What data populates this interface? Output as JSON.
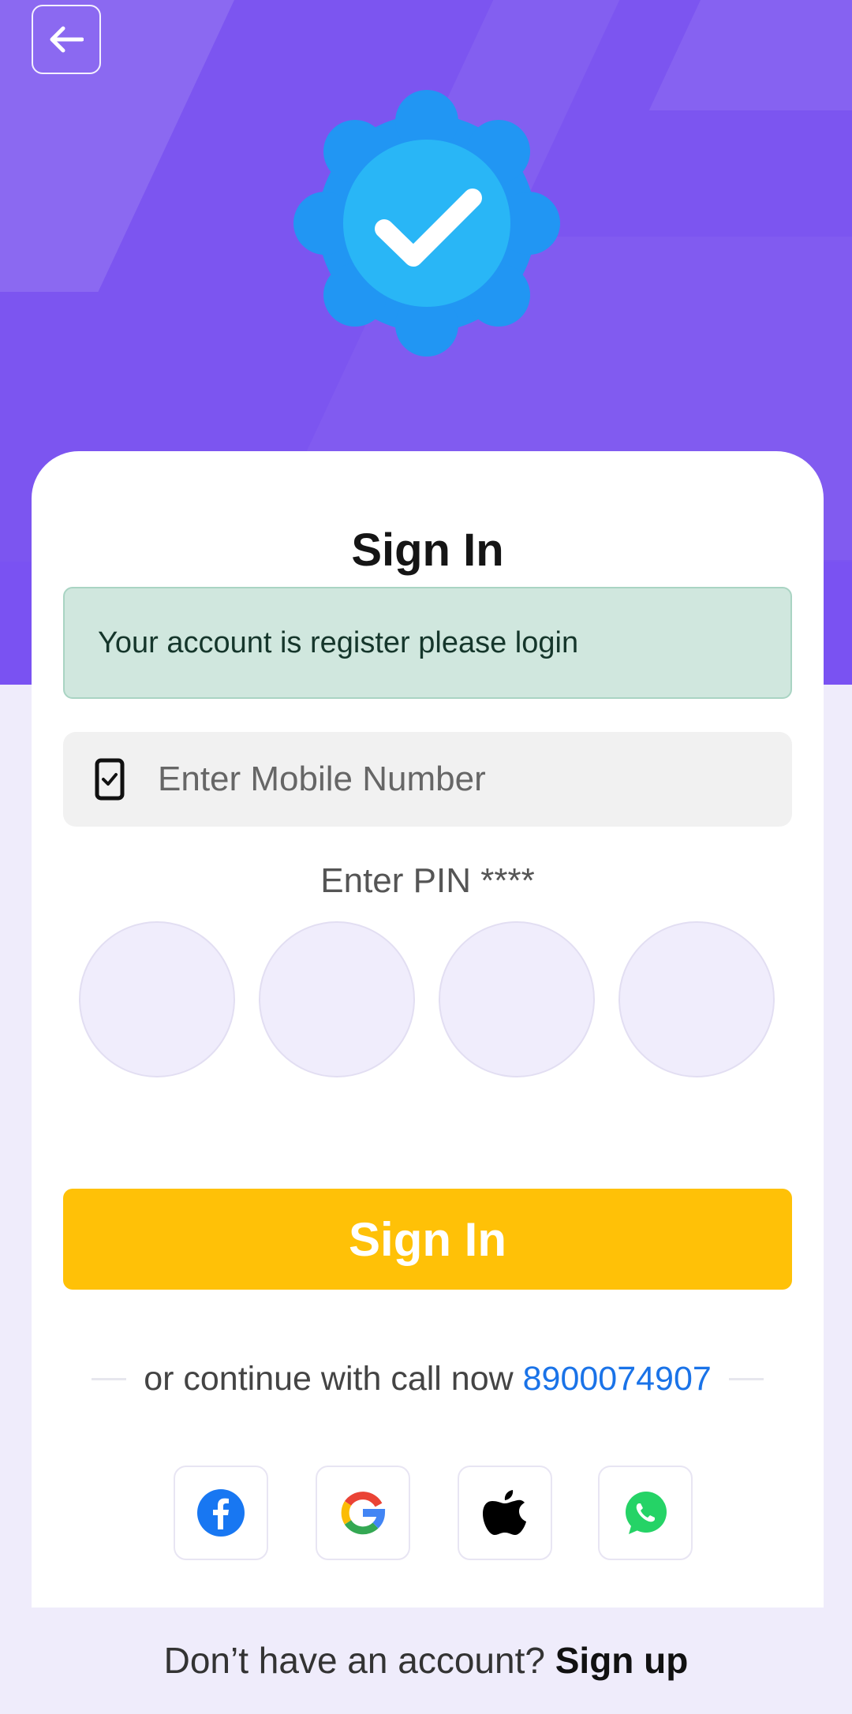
{
  "header": {
    "back_icon": "arrow-left-icon",
    "badge_icon": "verified-check-badge-icon",
    "colors": {
      "purple": "#7c55f0",
      "badge_outer": "#2196f3",
      "badge_inner": "#29b6f6"
    }
  },
  "form": {
    "title": "Sign In",
    "alert_text": "Your account is register please login",
    "mobile_placeholder": "Enter Mobile Number",
    "mobile_icon": "mobile-check-icon",
    "pin_label": "Enter PIN ****",
    "pin_digits": [
      "",
      "",
      "",
      ""
    ],
    "submit_label": "Sign In",
    "submit_color": "#ffc107"
  },
  "alt_login": {
    "prefix": "or continue with call now",
    "phone": "8900074907",
    "providers": [
      {
        "name": "facebook",
        "icon": "facebook-icon"
      },
      {
        "name": "google",
        "icon": "google-icon"
      },
      {
        "name": "apple",
        "icon": "apple-icon"
      },
      {
        "name": "whatsapp",
        "icon": "whatsapp-icon"
      }
    ]
  },
  "footer": {
    "question": "Don’t have an account?",
    "link": "Sign up"
  }
}
